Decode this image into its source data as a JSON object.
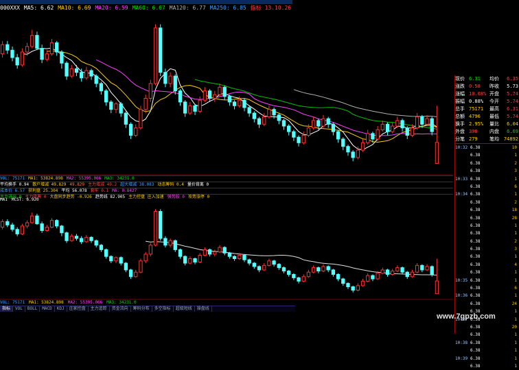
{
  "window": {
    "title": ""
  },
  "top_legend": {
    "code": "000XXX",
    "items": [
      {
        "text": "MA5: 6.62",
        "color": "#ffffff"
      },
      {
        "text": "MA10: 6.69",
        "color": "#ffd000"
      },
      {
        "text": "MA20: 6.59",
        "color": "#ff40ff"
      },
      {
        "text": "MA60: 6.67",
        "color": "#00e000"
      },
      {
        "text": "MA120: 6.77",
        "color": "#b0b0b0"
      },
      {
        "text": "MA250: 6.85",
        "color": "#40a0ff"
      },
      {
        "text": "指标 13.10.26",
        "color": "#ff4040"
      }
    ]
  },
  "indicator_rows": [
    [
      {
        "text": "VOL: 75171",
        "color": "#40a0ff"
      },
      {
        "text": "MA1: 53824.898",
        "color": "#ffd000"
      },
      {
        "text": "MA2: 55395.066",
        "color": "#ff40ff"
      },
      {
        "text": "MA3: 34231.0",
        "color": "#00e000"
      }
    ],
    [
      {
        "text": "平均换手 0.94",
        "color": "#ffffff"
      },
      {
        "text": "散户增减 49.829",
        "color": "#ffd000"
      },
      {
        "text": "49.829",
        "color": "#ff8040"
      },
      {
        "text": "主力增减 49.2",
        "color": "#ff4040"
      },
      {
        "text": "超大增减 38.083",
        "color": "#40a0ff"
      },
      {
        "text": "动态筹码 0.4",
        "color": "#ffd000"
      },
      {
        "text": "量价背离 0",
        "color": "#ffffff"
      }
    ],
    [
      {
        "text": "成本价 6.57",
        "color": "#40a0ff"
      },
      {
        "text": "获利盘 25.304",
        "color": "#ffd000"
      },
      {
        "text": "平均 56.078",
        "color": "#ffffff"
      },
      {
        "text": "套牢 0.1",
        "color": "#ff4040"
      },
      {
        "text": "MA: 0.8427",
        "color": "#ff40ff"
      }
    ],
    [
      {
        "text": "主力进出 0",
        "color": "#00e000"
      },
      {
        "text": "主力吸筹 0",
        "color": "#ff4040"
      },
      {
        "text": "大盘同步趋势 -0.926",
        "color": "#ffd000"
      },
      {
        "text": "趋势线 82.905",
        "color": "#ffffff"
      },
      {
        "text": "主力控盘 庄入加速",
        "color": "#ffd000"
      },
      {
        "text": "强势股 0",
        "color": "#ff40ff"
      },
      {
        "text": "攻势涨停 0",
        "color": "#ffd000"
      }
    ]
  ],
  "bottom_legend": [
    {
      "text": "MA1",
      "color": "#ffffff"
    },
    {
      "text": "MCST: 6.920",
      "color": "#ffffff"
    }
  ],
  "vol_legend": [
    {
      "text": "VOL: 75171",
      "color": "#40a0ff"
    },
    {
      "text": "MA1: 53824.898",
      "color": "#ffd000"
    },
    {
      "text": "MA2: 55395.066",
      "color": "#ff40ff"
    },
    {
      "text": "MA3: 34231.0",
      "color": "#00e000"
    }
  ],
  "tabs": [
    "指标",
    "VOL",
    "BOLL",
    "MACD",
    "KDJ",
    "庄家控盘",
    "主力追踪",
    "资金流向",
    "筹码分布",
    "多空指标",
    "超级短线",
    "操盘线"
  ],
  "active_tab": 0,
  "quote": {
    "rows": [
      {
        "k": "现价",
        "v": "6.31",
        "vc": "#00e000",
        "k2": "均价",
        "v2": "6.35",
        "v2c": "#ff4040"
      },
      {
        "k": "涨跌",
        "v": "0.58",
        "vc": "#ff4040",
        "k2": "昨收",
        "v2": "5.73",
        "v2c": "#ffffff"
      },
      {
        "k": "涨幅",
        "v": "10.08%",
        "vc": "#ff4040",
        "k2": "开盘",
        "v2": "5.74",
        "v2c": "#ff4040"
      },
      {
        "k": "振幅",
        "v": "0.88%",
        "vc": "#ffffff",
        "k2": "今开",
        "v2": "5.74",
        "v2c": "#ff4040"
      },
      {
        "k": "总手",
        "v": "75171",
        "vc": "#ffd000",
        "k2": "最高",
        "v2": "6.31",
        "v2c": "#ff4040"
      },
      {
        "k": "总额",
        "v": "4796",
        "vc": "#ffd000",
        "k2": "最低",
        "v2": "5.74",
        "v2c": "#ff4040"
      },
      {
        "k": "换手",
        "v": "2.95%",
        "vc": "#ffd000",
        "k2": "量比",
        "v2": "6.04",
        "v2c": "#ffd000"
      },
      {
        "k": "外盘",
        "v": "398",
        "vc": "#ff4040",
        "k2": "内盘",
        "v2": "6.69",
        "v2c": "#00e000"
      },
      {
        "k": "分笔",
        "v": "279",
        "vc": "#ffd000",
        "k2": "笔均",
        "v2": "74892",
        "v2c": "#ffd000"
      }
    ],
    "ticks": [
      {
        "t": "10:32",
        "p": "6.38",
        "q": "10"
      },
      {
        "t": "",
        "p": "6.38",
        "q": "1"
      },
      {
        "t": "",
        "p": "6.38",
        "q": "2"
      },
      {
        "t": "",
        "p": "6.38",
        "q": "3"
      },
      {
        "t": "10:33",
        "p": "6.38",
        "q": "1"
      },
      {
        "t": "",
        "p": "6.38",
        "q": "6"
      },
      {
        "t": "10:34",
        "p": "6.38",
        "q": "1"
      },
      {
        "t": "",
        "p": "6.38",
        "q": "2"
      },
      {
        "t": "",
        "p": "6.38",
        "q": "18"
      },
      {
        "t": "",
        "p": "6.38",
        "q": "28"
      },
      {
        "t": "",
        "p": "6.38",
        "q": "1"
      },
      {
        "t": "",
        "p": "6.38",
        "q": "1"
      },
      {
        "t": "",
        "p": "6.38",
        "q": "2"
      },
      {
        "t": "",
        "p": "6.38",
        "q": "3"
      },
      {
        "t": "",
        "p": "6.38",
        "q": "1"
      },
      {
        "t": "",
        "p": "6.38",
        "q": "4"
      },
      {
        "t": "",
        "p": "6.38",
        "q": "1"
      },
      {
        "t": "10:35",
        "p": "6.38",
        "q": "1"
      },
      {
        "t": "",
        "p": "6.38",
        "q": "6"
      },
      {
        "t": "10:36",
        "p": "6.38",
        "q": "1"
      },
      {
        "t": "",
        "p": "6.38",
        "q": "24"
      },
      {
        "t": "",
        "p": "6.38",
        "q": "1"
      },
      {
        "t": "10:37",
        "p": "6.38",
        "q": "1"
      },
      {
        "t": "",
        "p": "6.38",
        "q": "20"
      },
      {
        "t": "",
        "p": "6.38",
        "q": "1"
      },
      {
        "t": "10:38",
        "p": "6.38",
        "q": "1"
      },
      {
        "t": "",
        "p": "6.38",
        "q": "1"
      },
      {
        "t": "10:39",
        "p": "6.38",
        "q": "1"
      },
      {
        "t": "",
        "p": "6.38",
        "q": "1"
      }
    ]
  },
  "candles": [
    {
      "o": 8.7,
      "c": 8.95,
      "h": 9.05,
      "l": 8.6
    },
    {
      "o": 8.95,
      "c": 8.8,
      "h": 9.05,
      "l": 8.7
    },
    {
      "o": 8.8,
      "c": 8.6,
      "h": 8.9,
      "l": 8.5
    },
    {
      "o": 8.6,
      "c": 8.4,
      "h": 8.7,
      "l": 8.3
    },
    {
      "o": 8.4,
      "c": 8.75,
      "h": 8.85,
      "l": 8.35
    },
    {
      "o": 8.75,
      "c": 8.9,
      "h": 9.0,
      "l": 8.65
    },
    {
      "o": 8.9,
      "c": 9.2,
      "h": 9.35,
      "l": 8.85
    },
    {
      "o": 9.2,
      "c": 8.85,
      "h": 9.3,
      "l": 8.8
    },
    {
      "o": 8.85,
      "c": 8.55,
      "h": 8.95,
      "l": 8.45
    },
    {
      "o": 8.55,
      "c": 8.7,
      "h": 8.8,
      "l": 8.5
    },
    {
      "o": 8.7,
      "c": 9.0,
      "h": 9.1,
      "l": 8.65
    },
    {
      "o": 9.0,
      "c": 8.75,
      "h": 9.05,
      "l": 8.65
    },
    {
      "o": 8.75,
      "c": 8.45,
      "h": 8.8,
      "l": 8.3
    },
    {
      "o": 8.45,
      "c": 8.1,
      "h": 8.5,
      "l": 8.0
    },
    {
      "o": 8.1,
      "c": 8.3,
      "h": 8.4,
      "l": 8.05
    },
    {
      "o": 8.3,
      "c": 8.2,
      "h": 8.4,
      "l": 8.1
    },
    {
      "o": 8.2,
      "c": 8.05,
      "h": 8.3,
      "l": 7.95
    },
    {
      "o": 8.05,
      "c": 8.25,
      "h": 8.35,
      "l": 8.0
    },
    {
      "o": 8.25,
      "c": 8.1,
      "h": 8.3,
      "l": 8.0
    },
    {
      "o": 8.1,
      "c": 7.9,
      "h": 8.15,
      "l": 7.8
    },
    {
      "o": 7.9,
      "c": 7.7,
      "h": 7.95,
      "l": 7.6
    },
    {
      "o": 7.7,
      "c": 7.4,
      "h": 7.75,
      "l": 7.3
    },
    {
      "o": 7.4,
      "c": 7.2,
      "h": 7.45,
      "l": 7.1
    },
    {
      "o": 7.2,
      "c": 7.35,
      "h": 7.4,
      "l": 7.1
    },
    {
      "o": 7.35,
      "c": 7.1,
      "h": 7.4,
      "l": 7.0
    },
    {
      "o": 7.1,
      "c": 6.8,
      "h": 7.15,
      "l": 6.7
    },
    {
      "o": 6.8,
      "c": 6.5,
      "h": 6.85,
      "l": 6.4
    },
    {
      "o": 6.5,
      "c": 6.7,
      "h": 6.8,
      "l": 6.45
    },
    {
      "o": 6.7,
      "c": 7.2,
      "h": 7.3,
      "l": 6.65
    },
    {
      "o": 7.2,
      "c": 7.5,
      "h": 7.6,
      "l": 7.1
    },
    {
      "o": 7.5,
      "c": 7.9,
      "h": 8.0,
      "l": 7.4
    },
    {
      "o": 7.9,
      "c": 9.4,
      "h": 9.5,
      "l": 7.85
    },
    {
      "o": 9.4,
      "c": 8.2,
      "h": 9.5,
      "l": 8.1
    },
    {
      "o": 8.2,
      "c": 7.9,
      "h": 8.3,
      "l": 7.8
    },
    {
      "o": 7.9,
      "c": 8.1,
      "h": 8.2,
      "l": 7.8
    },
    {
      "o": 8.1,
      "c": 7.7,
      "h": 8.15,
      "l": 7.6
    },
    {
      "o": 7.7,
      "c": 7.4,
      "h": 7.75,
      "l": 7.3
    },
    {
      "o": 7.4,
      "c": 7.1,
      "h": 7.45,
      "l": 7.0
    },
    {
      "o": 7.1,
      "c": 7.3,
      "h": 7.4,
      "l": 7.05
    },
    {
      "o": 7.3,
      "c": 7.15,
      "h": 7.35,
      "l": 7.05
    },
    {
      "o": 7.15,
      "c": 7.45,
      "h": 7.55,
      "l": 7.1
    },
    {
      "o": 7.45,
      "c": 7.7,
      "h": 7.8,
      "l": 7.4
    },
    {
      "o": 7.7,
      "c": 7.5,
      "h": 7.75,
      "l": 7.4
    },
    {
      "o": 7.5,
      "c": 7.6,
      "h": 7.7,
      "l": 7.4
    },
    {
      "o": 7.6,
      "c": 7.8,
      "h": 7.9,
      "l": 7.55
    },
    {
      "o": 7.8,
      "c": 7.55,
      "h": 7.85,
      "l": 7.45
    },
    {
      "o": 7.55,
      "c": 7.4,
      "h": 7.6,
      "l": 7.3
    },
    {
      "o": 7.4,
      "c": 7.3,
      "h": 7.45,
      "l": 7.2
    },
    {
      "o": 7.3,
      "c": 7.45,
      "h": 7.55,
      "l": 7.25
    },
    {
      "o": 7.45,
      "c": 7.25,
      "h": 7.5,
      "l": 7.15
    },
    {
      "o": 7.25,
      "c": 7.1,
      "h": 7.3,
      "l": 7.0
    },
    {
      "o": 7.1,
      "c": 6.95,
      "h": 7.15,
      "l": 6.85
    },
    {
      "o": 6.95,
      "c": 6.8,
      "h": 7.0,
      "l": 6.7
    },
    {
      "o": 6.8,
      "c": 7.0,
      "h": 7.1,
      "l": 6.75
    },
    {
      "o": 7.0,
      "c": 7.2,
      "h": 7.3,
      "l": 6.95
    },
    {
      "o": 7.2,
      "c": 7.05,
      "h": 7.25,
      "l": 6.95
    },
    {
      "o": 7.05,
      "c": 6.9,
      "h": 7.1,
      "l": 6.8
    },
    {
      "o": 6.9,
      "c": 6.75,
      "h": 6.95,
      "l": 6.65
    },
    {
      "o": 6.75,
      "c": 6.6,
      "h": 6.8,
      "l": 6.5
    },
    {
      "o": 6.6,
      "c": 6.45,
      "h": 6.65,
      "l": 6.35
    },
    {
      "o": 6.45,
      "c": 6.3,
      "h": 6.5,
      "l": 6.2
    },
    {
      "o": 6.3,
      "c": 6.5,
      "h": 6.6,
      "l": 6.25
    },
    {
      "o": 6.5,
      "c": 6.7,
      "h": 6.8,
      "l": 6.45
    },
    {
      "o": 6.7,
      "c": 6.9,
      "h": 7.0,
      "l": 6.65
    },
    {
      "o": 6.9,
      "c": 6.75,
      "h": 6.95,
      "l": 6.65
    },
    {
      "o": 6.75,
      "c": 6.95,
      "h": 7.05,
      "l": 6.7
    },
    {
      "o": 6.95,
      "c": 6.8,
      "h": 7.0,
      "l": 6.7
    },
    {
      "o": 6.8,
      "c": 6.6,
      "h": 6.85,
      "l": 6.5
    },
    {
      "o": 6.6,
      "c": 6.4,
      "h": 6.65,
      "l": 6.3
    },
    {
      "o": 6.4,
      "c": 6.2,
      "h": 6.45,
      "l": 6.1
    },
    {
      "o": 6.2,
      "c": 6.05,
      "h": 6.25,
      "l": 5.95
    },
    {
      "o": 6.05,
      "c": 5.9,
      "h": 6.1,
      "l": 5.8
    },
    {
      "o": 5.9,
      "c": 6.1,
      "h": 6.2,
      "l": 5.85
    },
    {
      "o": 6.1,
      "c": 6.3,
      "h": 6.4,
      "l": 6.05
    },
    {
      "o": 6.3,
      "c": 6.55,
      "h": 6.65,
      "l": 6.25
    },
    {
      "o": 6.55,
      "c": 6.4,
      "h": 6.6,
      "l": 6.3
    },
    {
      "o": 6.4,
      "c": 6.65,
      "h": 6.75,
      "l": 6.35
    },
    {
      "o": 6.65,
      "c": 6.8,
      "h": 6.9,
      "l": 6.6
    },
    {
      "o": 6.8,
      "c": 6.6,
      "h": 6.85,
      "l": 6.5
    },
    {
      "o": 6.6,
      "c": 6.75,
      "h": 6.85,
      "l": 6.55
    },
    {
      "o": 6.75,
      "c": 6.9,
      "h": 7.0,
      "l": 6.7
    },
    {
      "o": 6.9,
      "c": 6.7,
      "h": 6.95,
      "l": 6.6
    },
    {
      "o": 6.7,
      "c": 6.5,
      "h": 6.75,
      "l": 6.4
    },
    {
      "o": 6.5,
      "c": 6.7,
      "h": 6.8,
      "l": 6.45
    },
    {
      "o": 6.7,
      "c": 7.0,
      "h": 7.1,
      "l": 6.65
    },
    {
      "o": 7.0,
      "c": 6.8,
      "h": 7.05,
      "l": 6.7
    },
    {
      "o": 6.8,
      "c": 6.95,
      "h": 7.05,
      "l": 6.75
    },
    {
      "o": 6.95,
      "c": 6.6,
      "h": 7.0,
      "l": 6.5
    },
    {
      "o": 5.74,
      "c": 6.31,
      "h": 7.3,
      "l": 5.74
    }
  ]
}
